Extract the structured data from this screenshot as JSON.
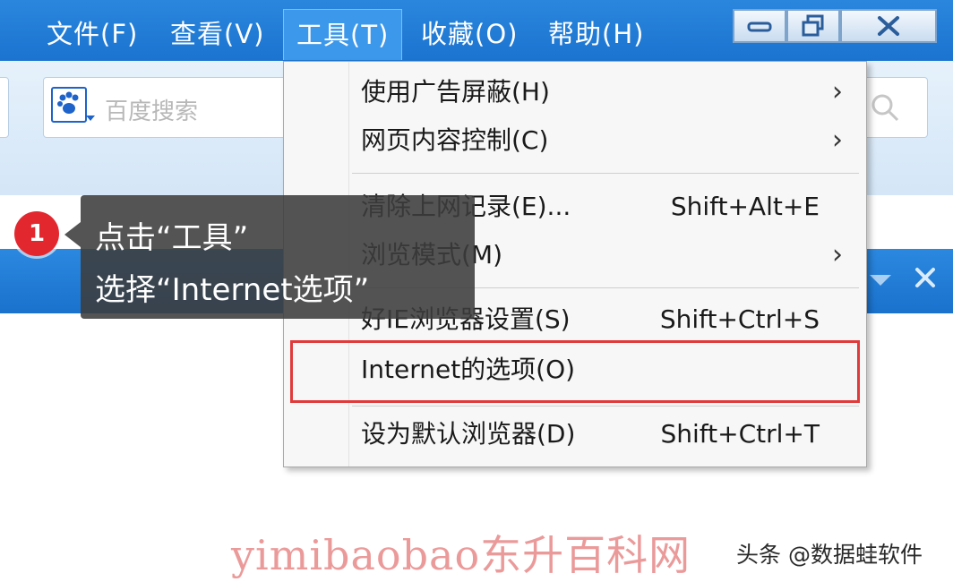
{
  "menubar": {
    "items": [
      "文件(F)",
      "查看(V)",
      "工具(T)",
      "收藏(O)",
      "帮助(H)"
    ],
    "active_index": 2,
    "window_buttons": [
      "minimize-icon",
      "restore-icon",
      "close-icon"
    ]
  },
  "toolbar": {
    "search_placeholder": "百度搜索",
    "search_engine_icon": "baidu-paw-icon",
    "search_button_icon": "search-icon"
  },
  "callout": {
    "step_number": "1",
    "line1": "点击“工具”",
    "line2": "选择“Internet选项”"
  },
  "tools_menu": {
    "items": [
      {
        "label": "使用广告屏蔽(H)",
        "shortcut": "",
        "submenu": true
      },
      {
        "label": "网页内容控制(C)",
        "shortcut": "",
        "submenu": true
      },
      {
        "label": "清除上网记录(E)...",
        "shortcut": "Shift+Alt+E",
        "submenu": false
      },
      {
        "label": "浏览模式(M)",
        "shortcut": "",
        "submenu": true
      },
      {
        "label": "好IE浏览器设置(S)",
        "shortcut": "Shift+Ctrl+S",
        "submenu": false
      },
      {
        "label": "Internet的选项(O)",
        "shortcut": "",
        "submenu": false,
        "highlighted": true
      },
      {
        "label": "设为默认浏览器(D)",
        "shortcut": "Shift+Ctrl+T",
        "submenu": false
      }
    ]
  },
  "colors": {
    "menubar_blue": "#1b74d0",
    "highlight_red": "#e03a3a",
    "badge_red": "#e2272f"
  },
  "watermark": {
    "left": "yimibaobao东升百科网",
    "right": "头条 @数据蛙软件"
  }
}
